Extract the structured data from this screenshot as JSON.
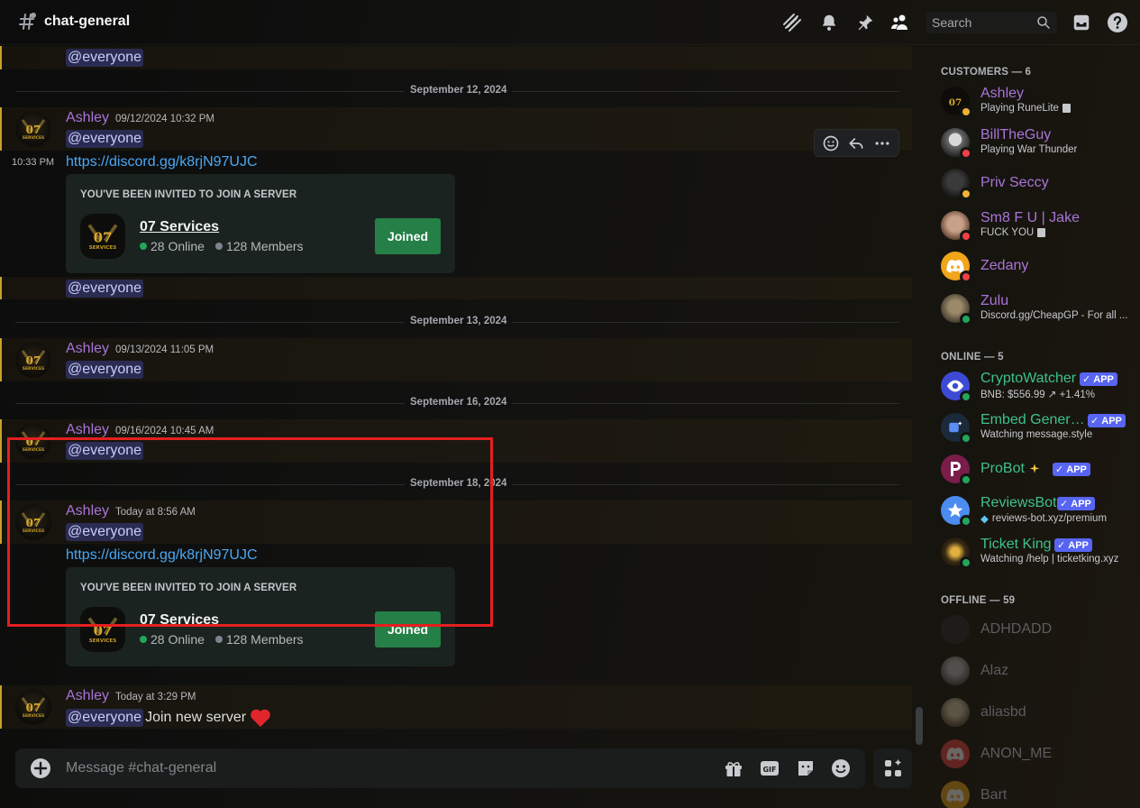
{
  "header": {
    "channel_name": "chat-general",
    "search_placeholder": "Search"
  },
  "messages": {
    "top_mention": "@everyone",
    "dividers": [
      {
        "label": "September 12, 2024"
      },
      {
        "label": "September 13, 2024"
      },
      {
        "label": "September 16, 2024"
      },
      {
        "label": "September 18, 2024"
      }
    ],
    "groups": [
      {
        "author": "Ashley",
        "timestamp": "09/12/2024 10:32 PM",
        "mention": "@everyone",
        "side_time": "10:33 PM",
        "link": "https://discord.gg/k8rjN97UJC",
        "invite": {
          "title": "YOU'VE BEEN INVITED TO JOIN A SERVER",
          "server_name": "07 Services",
          "online": "28 Online",
          "members": "128 Members",
          "button": "Joined"
        },
        "trailing_mention": "@everyone"
      },
      {
        "author": "Ashley",
        "timestamp": "09/13/2024 11:05 PM",
        "mention": "@everyone"
      },
      {
        "author": "Ashley",
        "timestamp": "09/16/2024 10:45 AM",
        "mention": "@everyone"
      },
      {
        "author": "Ashley",
        "timestamp": "Today at 8:56 AM",
        "mention": "@everyone",
        "link": "https://discord.gg/k8rjN97UJC",
        "invite": {
          "title": "YOU'VE BEEN INVITED TO JOIN A SERVER",
          "server_name": "07 Services",
          "online": "28 Online",
          "members": "128 Members",
          "button": "Joined"
        }
      },
      {
        "author": "Ashley",
        "timestamp": "Today at 3:29 PM",
        "mention": "@everyone",
        "text": "Join new server"
      }
    ]
  },
  "composer": {
    "placeholder": "Message #chat-general"
  },
  "members": {
    "customers_title": "CUSTOMERS — 6",
    "online_title": "ONLINE — 5",
    "offline_title": "OFFLINE — 59",
    "app_badge": "APP",
    "customers": [
      {
        "name": "Ashley",
        "status": "Playing RuneLite",
        "color": "#a974d9",
        "presence": "idle"
      },
      {
        "name": "BillTheGuy",
        "status": "Playing War Thunder",
        "color": "#a974d9",
        "presence": "dnd"
      },
      {
        "name": "Priv Seccy",
        "status": "",
        "color": "#a974d9",
        "presence": "idle"
      },
      {
        "name": "Sm8 F U | Jake",
        "status": "FUCK YOU",
        "color": "#a974d9",
        "presence": "dnd"
      },
      {
        "name": "Zedany",
        "status": "",
        "color": "#a974d9",
        "presence": "dnd"
      },
      {
        "name": "Zulu",
        "status": "Discord.gg/CheapGP - For all ...",
        "color": "#a974d9",
        "presence": "online"
      }
    ],
    "online": [
      {
        "name": "CryptoWatcher",
        "status": "BNB: $556.99 ↗ +1.41%",
        "color": "#3ec28a"
      },
      {
        "name": "Embed Genera...",
        "status": "Watching message.style",
        "color": "#3ec28a"
      },
      {
        "name": "ProBot",
        "status": "",
        "color": "#3ec28a"
      },
      {
        "name": "ReviewsBot",
        "status": "reviews-bot.xyz/premium",
        "color": "#3ec28a"
      },
      {
        "name": "Ticket King",
        "status": "Watching /help | ticketking.xyz",
        "color": "#3ec28a"
      }
    ],
    "offline": [
      {
        "name": "ADHDADD"
      },
      {
        "name": "Alaz"
      },
      {
        "name": "aliasbd"
      },
      {
        "name": "ANON_ME"
      },
      {
        "name": "Bart"
      }
    ]
  },
  "colors": {
    "accent": "#5865f2",
    "author": "#a974d9",
    "bot_name": "#3ec28a",
    "link": "#4aa8f5",
    "joined_button": "#248046",
    "online": "#23a55a",
    "idle": "#f0b232",
    "dnd": "#f23f43",
    "highlight": "#e41f1f"
  }
}
